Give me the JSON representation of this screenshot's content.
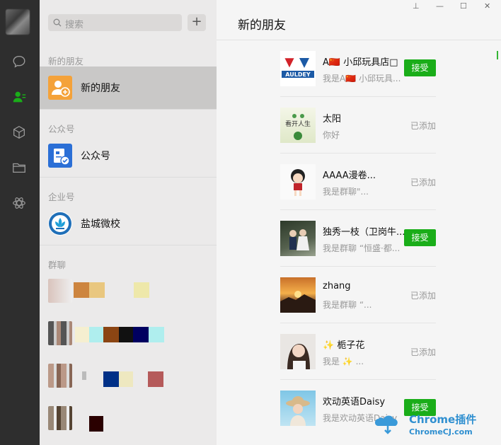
{
  "search": {
    "placeholder": "搜索"
  },
  "add_button": "+",
  "sections": {
    "new_friends_label": "新的朋友",
    "new_friends_item": "新的朋友",
    "official_label": "公众号",
    "official_item": "公众号",
    "enterprise_label": "企业号",
    "enterprise_item": "盐城微校",
    "group_label": "群聊"
  },
  "window": {
    "pin": "⊥",
    "minimize": "—",
    "maximize": "☐",
    "close": "✕"
  },
  "main": {
    "title": "新的朋友"
  },
  "friends": [
    {
      "name": "A🇨🇳 小邱玩具店□",
      "msg": "我是A🇨🇳 小邱玩具...",
      "status": "接受"
    },
    {
      "name": "太阳",
      "msg": "你好",
      "status": "已添加"
    },
    {
      "name": "AAAA漫卷...",
      "msg": "我是群聊\"...",
      "status": "已添加"
    },
    {
      "name": "独秀一枝（卫岗牛...",
      "msg": "我是群聊 “恒盛·都...",
      "status": "接受"
    },
    {
      "name": "zhang",
      "msg": "我是群聊 “...",
      "status": "已添加"
    },
    {
      "name": "✨ 栀子花",
      "msg": "我是 ✨ ...",
      "status": "已添加"
    },
    {
      "name": "欢动英语Daisy",
      "msg": "我是欢动英语Daisy",
      "status": "接受"
    }
  ],
  "auldey_logo_text": "AULDEY",
  "watermark": {
    "line1": "Chrome插件",
    "line2": "ChromeCJ.com"
  }
}
